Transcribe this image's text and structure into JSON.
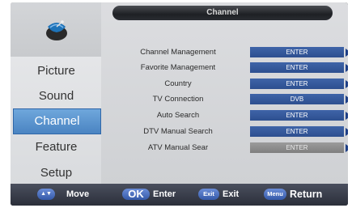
{
  "header": {
    "title": "Channel"
  },
  "sidebar": {
    "items": [
      {
        "label": "Picture"
      },
      {
        "label": "Sound"
      },
      {
        "label": "Channel"
      },
      {
        "label": "Feature"
      },
      {
        "label": "Setup"
      }
    ],
    "active_item": "Channel"
  },
  "rows": [
    {
      "label": "Channel Management",
      "value": "ENTER"
    },
    {
      "label": "Favorite Management",
      "value": "ENTER"
    },
    {
      "label": "Country",
      "value": "ENTER"
    },
    {
      "label": "TV Connection",
      "value": "DVB"
    },
    {
      "label": "Auto Search",
      "value": "ENTER"
    },
    {
      "label": "DTV Manual Search",
      "value": "ENTER"
    },
    {
      "label": "ATV Manual Sear",
      "value": "ENTER",
      "disabled": true
    }
  ],
  "footer": {
    "move_key": "▲▼",
    "move_label": "Move",
    "ok_key": "OK",
    "ok_label": "Enter",
    "exit_key": "Exit",
    "exit_label": "Exit",
    "menu_key": "Menu",
    "menu_label": "Return"
  },
  "colors": {
    "accent_blue": "#2d4f8f",
    "active_tab": "#4a84c2",
    "disabled_button": "#8a8a8a"
  }
}
